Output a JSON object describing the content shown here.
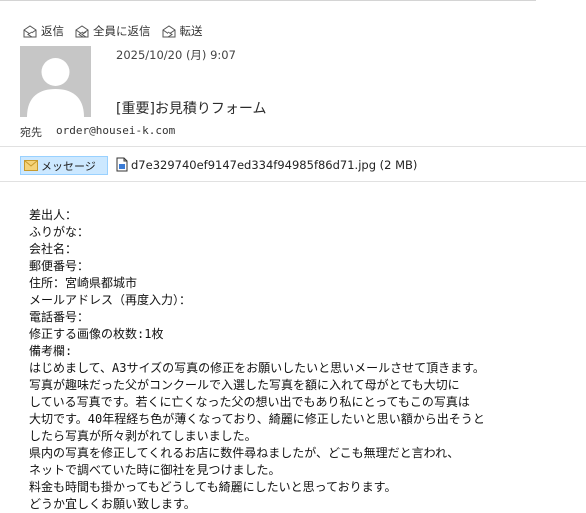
{
  "toolbar": {
    "reply_label": "返信",
    "reply_all_label": "全員に返信",
    "forward_label": "転送"
  },
  "header": {
    "date": "2025/10/20 (月) 9:07",
    "subject": "[重要]お見積りフォーム",
    "to_label": "宛先",
    "to_value": "order@housei-k.com"
  },
  "tabs": {
    "message_label": "メッセージ",
    "attachment_label": "d7e329740ef9147ed334f94985f86d71.jpg (2 MB)"
  },
  "message_lines": [
    "差出人：",
    "ふりがな：",
    "会社名：",
    "郵便番号：",
    "住所：宮崎県都城市",
    "メールアドレス（再度入力）：",
    "電話番号：",
    "修正する画像の枚数:1枚",
    "備考欄:",
    "はじめまして、A3サイズの写真の修正をお願いしたいと思いメールさせて頂きます。",
    "写真が趣味だった父がコンクールで入選した写真を額に入れて母がとても大切に",
    "している写真です。若くに亡くなった父の想い出でもあり私にとってもこの写真は",
    "大切です。40年程経ち色が薄くなっており、綺麗に修正したいと思い額から出そうと",
    "したら写真が所々剥がれてしまいました。",
    "県内の写真を修正してくれるお店に数件尋ねましたが、どこも無理だと言われ、",
    "ネットで調べていた時に御社を見つけました。",
    "料金も時間も掛かってもどうしても綺麗にしたいと思っております。",
    "どうか宜しくお願い致します。"
  ],
  "colors": {
    "message_tab_bg": "#cce8ff",
    "avatar_bg": "#c6c6c6"
  }
}
